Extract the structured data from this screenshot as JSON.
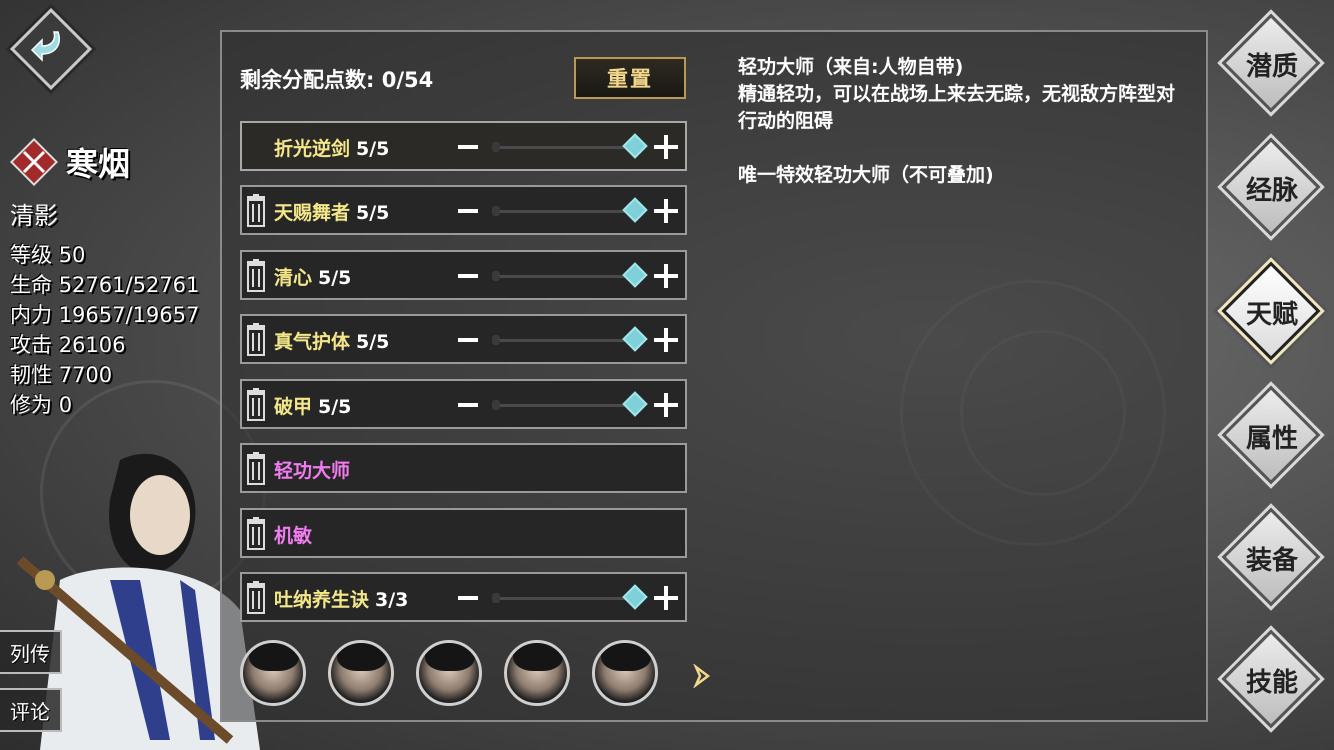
{
  "character": {
    "name": "寒烟",
    "title": "清影",
    "stats": [
      {
        "label": "等级",
        "value": "50"
      },
      {
        "label": "生命",
        "value": "52761/52761"
      },
      {
        "label": "内力",
        "value": "19657/19657"
      },
      {
        "label": "攻击",
        "value": "26106"
      },
      {
        "label": "韧性",
        "value": "7700"
      },
      {
        "label": "修为",
        "value": "0"
      }
    ]
  },
  "side_tabs": {
    "biography": "列传",
    "comments": "评论"
  },
  "talent_panel": {
    "points_label": "剩余分配点数: 0/54",
    "reset_label": "重置",
    "talents": [
      {
        "name": "折光逆剑",
        "level": "5/5",
        "color": "yellow",
        "deletable": false,
        "has_slider": true
      },
      {
        "name": "天赐舞者",
        "level": "5/5",
        "color": "yellow",
        "deletable": true,
        "has_slider": true
      },
      {
        "name": "清心",
        "level": "5/5",
        "color": "yellow",
        "deletable": true,
        "has_slider": true
      },
      {
        "name": "真气护体",
        "level": "5/5",
        "color": "yellow",
        "deletable": true,
        "has_slider": true
      },
      {
        "name": "破甲",
        "level": "5/5",
        "color": "yellow",
        "deletable": true,
        "has_slider": true
      },
      {
        "name": "轻功大师",
        "level": "",
        "color": "pink",
        "deletable": true,
        "has_slider": false
      },
      {
        "name": "机敏",
        "level": "",
        "color": "pink",
        "deletable": true,
        "has_slider": false
      },
      {
        "name": "吐纳养生诀",
        "level": "3/3",
        "color": "yellow",
        "deletable": true,
        "has_slider": true
      }
    ]
  },
  "description": {
    "line1": "轻功大师（来自:人物自带)",
    "line2": "精通轻功，可以在战场上来去无踪，无视敌方阵型对行动的阻碍",
    "line3": "唯一特效轻功大师（不可叠加)"
  },
  "companions_count": 5,
  "right_tabs": [
    {
      "label": "潜质",
      "active": false
    },
    {
      "label": "经脉",
      "active": false
    },
    {
      "label": "天赋",
      "active": true
    },
    {
      "label": "属性",
      "active": false
    },
    {
      "label": "装备",
      "active": false
    },
    {
      "label": "技能",
      "active": false
    }
  ],
  "colors": {
    "talent_yellow": "#f4e78a",
    "talent_pink": "#f07cf0",
    "slider_knob": "#7fd0d8",
    "reset_text": "#f3d88c"
  },
  "icons": {
    "back": "back-arrow-icon",
    "faction": "crossed-swords-icon",
    "trash": "trash-icon",
    "minus": "minus-icon",
    "plus": "plus-icon",
    "next": "chevron-right-icon"
  }
}
